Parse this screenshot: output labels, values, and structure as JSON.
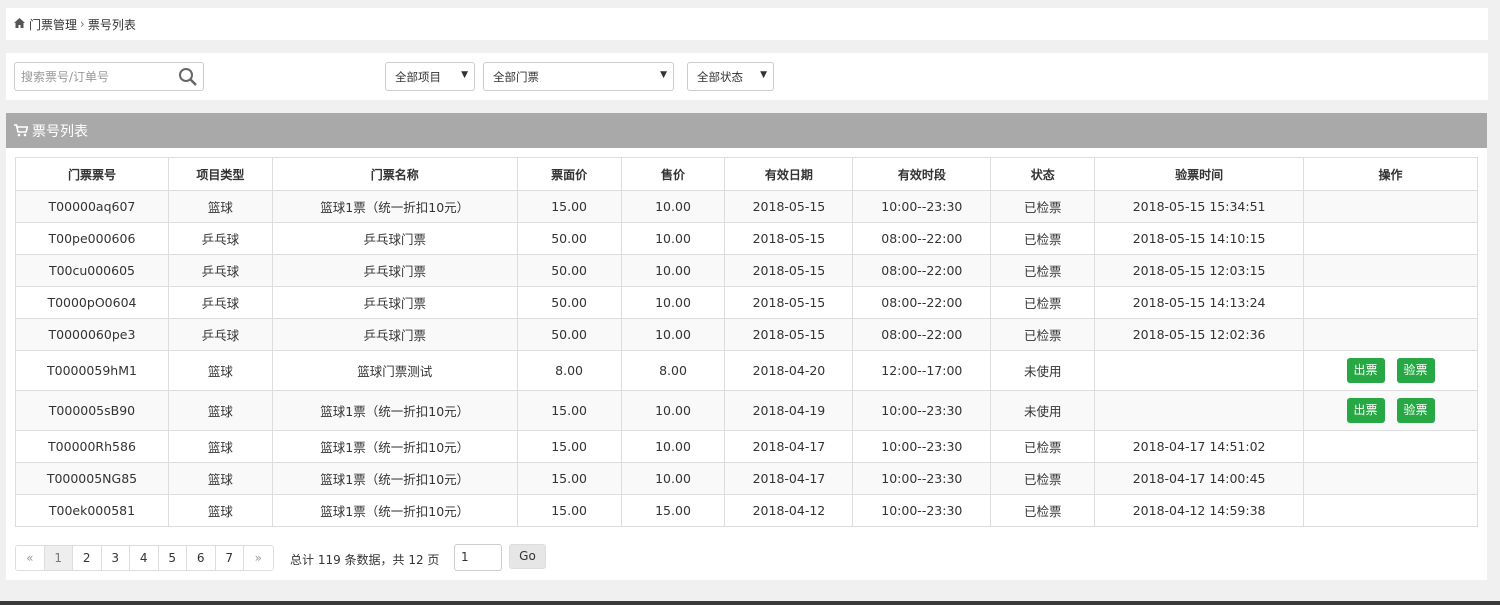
{
  "breadcrumb": {
    "home_icon": "home-icon",
    "parent": "门票管理",
    "separator": "›",
    "current": "票号列表"
  },
  "filters": {
    "search_placeholder": "搜索票号/订单号",
    "project_select": "全部项目",
    "ticket_select": "全部门票",
    "status_select": "全部状态"
  },
  "panel": {
    "title": "票号列表",
    "icon": "cart-icon"
  },
  "table": {
    "headers": [
      "门票票号",
      "项目类型",
      "门票名称",
      "票面价",
      "售价",
      "有效日期",
      "有效时段",
      "状态",
      "验票时间",
      "操作"
    ],
    "rows": [
      {
        "ticket_no": "T00000aq607",
        "type": "篮球",
        "name": "篮球1票（统一折扣10元）",
        "face_price": "15.00",
        "price": "10.00",
        "valid_date": "2018-05-15",
        "valid_time": "10:00--23:30",
        "status": "已检票",
        "check_time": "2018-05-15 15:34:51"
      },
      {
        "ticket_no": "T00pe000606",
        "type": "乒乓球",
        "name": "乒乓球门票",
        "face_price": "50.00",
        "price": "10.00",
        "valid_date": "2018-05-15",
        "valid_time": "08:00--22:00",
        "status": "已检票",
        "check_time": "2018-05-15 14:10:15"
      },
      {
        "ticket_no": "T00cu000605",
        "type": "乒乓球",
        "name": "乒乓球门票",
        "face_price": "50.00",
        "price": "10.00",
        "valid_date": "2018-05-15",
        "valid_time": "08:00--22:00",
        "status": "已检票",
        "check_time": "2018-05-15 12:03:15"
      },
      {
        "ticket_no": "T0000pO0604",
        "type": "乒乓球",
        "name": "乒乓球门票",
        "face_price": "50.00",
        "price": "10.00",
        "valid_date": "2018-05-15",
        "valid_time": "08:00--22:00",
        "status": "已检票",
        "check_time": "2018-05-15 14:13:24"
      },
      {
        "ticket_no": "T0000060pe3",
        "type": "乒乓球",
        "name": "乒乓球门票",
        "face_price": "50.00",
        "price": "10.00",
        "valid_date": "2018-05-15",
        "valid_time": "08:00--22:00",
        "status": "已检票",
        "check_time": "2018-05-15 12:02:36"
      },
      {
        "ticket_no": "T0000059hM1",
        "type": "篮球",
        "name": "篮球门票测试",
        "face_price": "8.00",
        "price": "8.00",
        "valid_date": "2018-04-20",
        "valid_time": "12:00--17:00",
        "status": "未使用",
        "check_time": ""
      },
      {
        "ticket_no": "T000005sB90",
        "type": "篮球",
        "name": "篮球1票（统一折扣10元）",
        "face_price": "15.00",
        "price": "10.00",
        "valid_date": "2018-04-19",
        "valid_time": "10:00--23:30",
        "status": "未使用",
        "check_time": ""
      },
      {
        "ticket_no": "T00000Rh586",
        "type": "篮球",
        "name": "篮球1票（统一折扣10元）",
        "face_price": "15.00",
        "price": "10.00",
        "valid_date": "2018-04-17",
        "valid_time": "10:00--23:30",
        "status": "已检票",
        "check_time": "2018-04-17 14:51:02"
      },
      {
        "ticket_no": "T000005NG85",
        "type": "篮球",
        "name": "篮球1票（统一折扣10元）",
        "face_price": "15.00",
        "price": "10.00",
        "valid_date": "2018-04-17",
        "valid_time": "10:00--23:30",
        "status": "已检票",
        "check_time": "2018-04-17 14:00:45"
      },
      {
        "ticket_no": "T00ek000581",
        "type": "篮球",
        "name": "篮球1票（统一折扣10元）",
        "face_price": "15.00",
        "price": "15.00",
        "valid_date": "2018-04-12",
        "valid_time": "10:00--23:30",
        "status": "已检票",
        "check_time": "2018-04-12 14:59:38"
      }
    ],
    "action_issue": "出票",
    "action_check": "验票"
  },
  "pagination": {
    "prev": "«",
    "pages": [
      "1",
      "2",
      "3",
      "4",
      "5",
      "6",
      "7"
    ],
    "next": "»",
    "current_page": "1",
    "summary": "总计 119 条数据，共 12 页",
    "input_value": "1",
    "go_label": "Go"
  },
  "colors": {
    "panel_header": "#a9a9a9",
    "action_button": "#28a745"
  }
}
